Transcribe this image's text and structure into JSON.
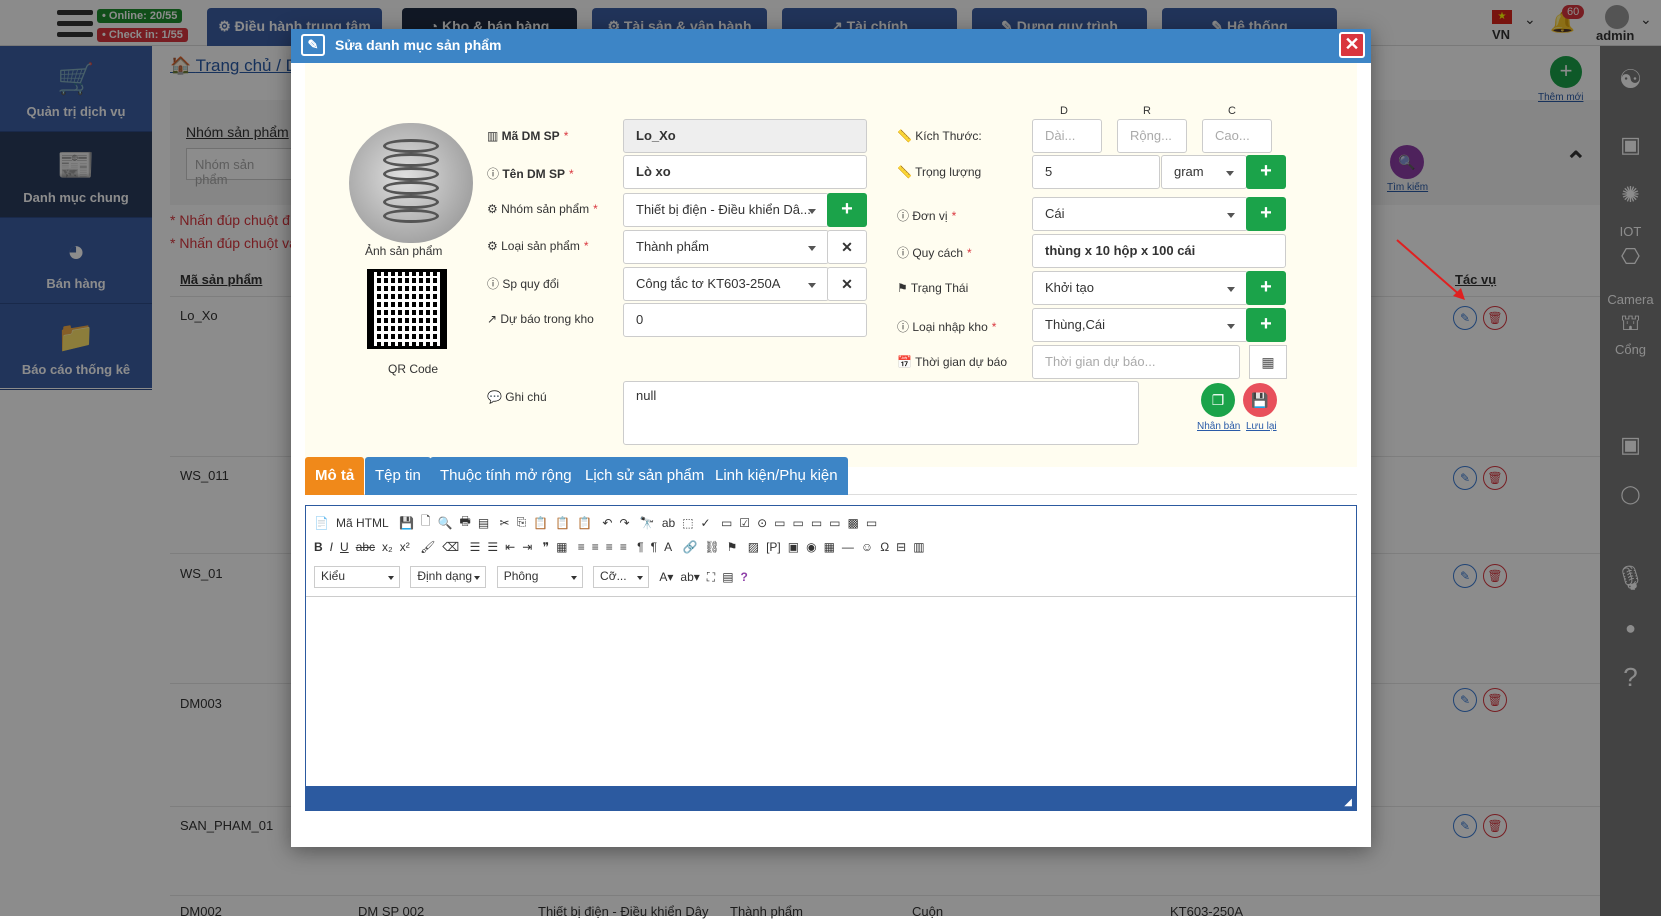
{
  "topbar": {
    "online": "• Online: 20/55",
    "checkin": "• Check in: 1/55",
    "tabs": [
      "Điều hành trung tâm",
      "Kho & bán hàng",
      "Tài sản & vận hành",
      "Tài chính",
      "Dựng quy trình",
      "Hệ thống"
    ],
    "lang": "VN",
    "notif_count": "60",
    "user": "admin"
  },
  "sidebar": {
    "items": [
      {
        "label": "Quản trị dịch vụ",
        "icon": "cart-icon"
      },
      {
        "label": "Danh mục chung",
        "icon": "newspaper-icon"
      },
      {
        "label": "Bán hàng",
        "icon": "pie-chart-icon"
      },
      {
        "label": "Báo cáo thống kê",
        "icon": "folder-icon"
      }
    ]
  },
  "rightbar": {
    "iot": "IOT",
    "camera": "Camera",
    "cong": "Cổng"
  },
  "page": {
    "breadcrumb": "Trang chủ / D",
    "filter_label": "Nhóm sản phẩm",
    "filter_placeholder": "Nhóm sản phẩm",
    "note1": "* Nhấn đúp chuột đ",
    "note2": "* Nhấn đúp chuột và",
    "col_code": "Mã sản phẩm",
    "col_action": "Tác vụ",
    "add_label": "Thêm mới",
    "search_label": "Tìm kiếm",
    "rows": [
      "Lo_Xo",
      "WS_011",
      "WS_01",
      "DM003",
      "SAN_PHAM_01",
      "DM002"
    ],
    "last_row": {
      "name": "DM SP 002",
      "group": "Thiết bị điện - Điều khiển Dây",
      "type": "Thành phẩm",
      "unit": "Cuộn",
      "convert": "KT603-250A"
    }
  },
  "modal": {
    "title": "Sửa danh mục sản phẩm",
    "photo_label": "Ảnh sản phẩm",
    "qr_label": "QR Code",
    "fields": {
      "code_label": "Mã DM SP",
      "code_value": "Lo_Xo",
      "name_label": "Tên DM SP",
      "name_value": "Lò xo",
      "group_label": "Nhóm sản phẩm",
      "group_value": "Thiết bị điện - Điều khiển Dâ...",
      "type_label": "Loại sản phẩm",
      "type_value": "Thành phẩm",
      "convert_label": "Sp quy đổi",
      "convert_value": "Công tắc tơ KT603-250A",
      "forecast_label": "Dự báo trong kho",
      "forecast_value": "0",
      "note_label": "Ghi chú",
      "note_value": "null",
      "size_label": "Kích Thước:",
      "size_d": "D",
      "size_r": "R",
      "size_c": "C",
      "size_d_ph": "Dài...",
      "size_r_ph": "Rộng...",
      "size_c_ph": "Cao...",
      "weight_label": "Trọng lượng",
      "weight_value": "5",
      "weight_unit": "gram",
      "unit_label": "Đơn vị",
      "unit_value": "Cái",
      "spec_label": "Quy cách",
      "spec_value": "thùng x 10 hộp x 100 cái",
      "status_label": "Trạng Thái",
      "status_value": "Khởi tạo",
      "import_label": "Loại nhập kho",
      "import_value": "Thùng,Cái",
      "forecast_time_label": "Thời gian dự báo",
      "forecast_time_ph": "Thời gian dự báo..."
    },
    "duplicate_label": "Nhân bản",
    "save_label": "Lưu lại",
    "tabs": [
      "Mô tả",
      "Tệp tin",
      "Thuộc tính mở rộng",
      "Lịch sử sản phẩm",
      "Linh kiện/Phụ kiện"
    ],
    "editor": {
      "source": "Mã HTML",
      "style": "Kiểu",
      "format": "Định dạng",
      "font": "Phông",
      "size": "Cỡ..."
    }
  }
}
